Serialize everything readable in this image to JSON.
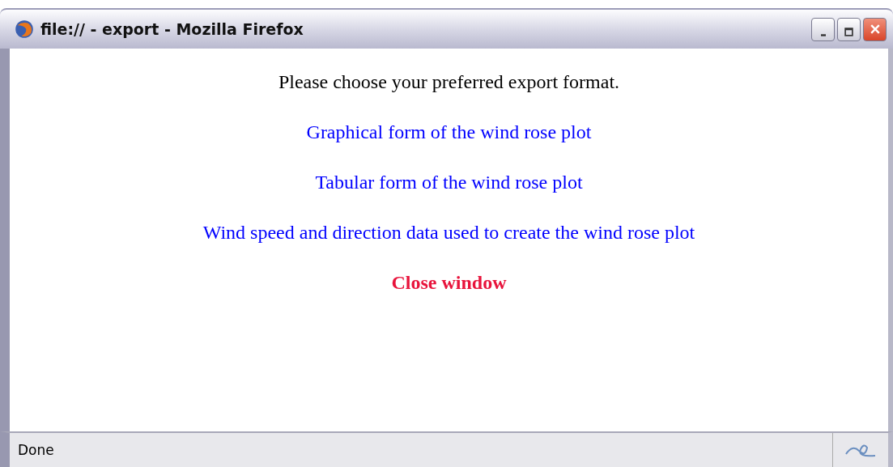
{
  "window": {
    "title": "file:// - export - Mozilla Firefox"
  },
  "content": [
    {
      "kind": "text",
      "text": "Please choose your preferred export format."
    },
    {
      "kind": "link",
      "text": "Graphical form of the wind rose plot"
    },
    {
      "kind": "link",
      "text": "Tabular form of the wind rose plot"
    },
    {
      "kind": "link",
      "text": "Wind speed and direction data used to create the wind rose plot"
    },
    {
      "kind": "close",
      "text": "Close window"
    }
  ],
  "status_bar": {
    "text": "Done"
  }
}
